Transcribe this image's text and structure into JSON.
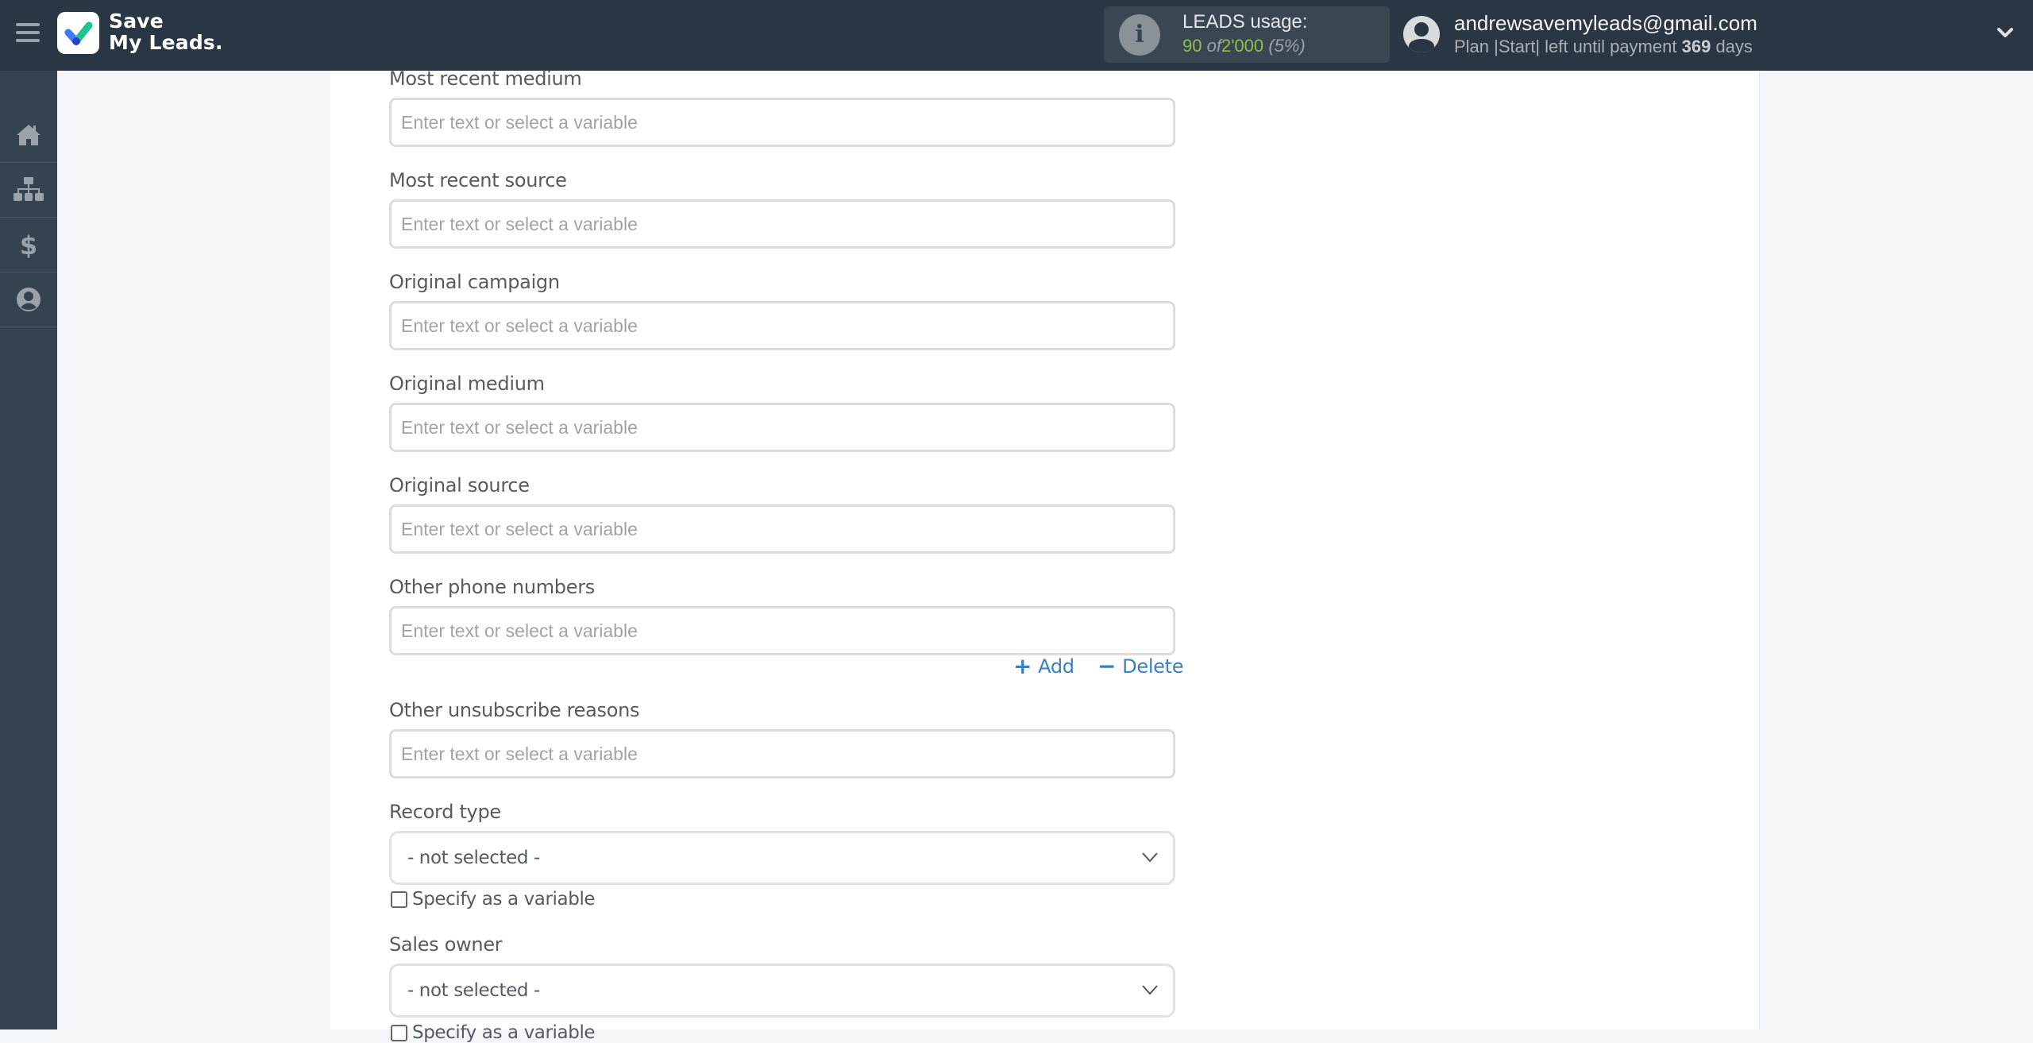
{
  "header": {
    "logo_line1": "Save",
    "logo_line2": "My Leads.",
    "usage": {
      "title": "LEADS usage:",
      "used": "90",
      "of_word": "of",
      "limit": "2'000",
      "percent": "(5%)",
      "used_color": "#8ec04a"
    },
    "user": {
      "email": "andrewsavemyleads@gmail.com",
      "plan_prefix": "Plan |Start| left until payment",
      "days": "369",
      "days_suffix": "days"
    }
  },
  "sidebar": {
    "items": [
      {
        "name": "home",
        "icon": "home-icon"
      },
      {
        "name": "connections",
        "icon": "sitemap-icon"
      },
      {
        "name": "billing",
        "icon": "dollar-icon"
      },
      {
        "name": "account",
        "icon": "user-circle-icon"
      }
    ]
  },
  "form": {
    "fields": [
      {
        "label": "Most recent medium",
        "placeholder": "Enter text or select a variable",
        "value": ""
      },
      {
        "label": "Most recent source",
        "placeholder": "Enter text or select a variable",
        "value": ""
      },
      {
        "label": "Original campaign",
        "placeholder": "Enter text or select a variable",
        "value": ""
      },
      {
        "label": "Original medium",
        "placeholder": "Enter text or select a variable",
        "value": ""
      },
      {
        "label": "Original source",
        "placeholder": "Enter text or select a variable",
        "value": ""
      },
      {
        "label": "Other phone numbers",
        "placeholder": "Enter text or select a variable",
        "value": ""
      },
      {
        "label": "Other unsubscribe reasons",
        "placeholder": "Enter text or select a variable",
        "value": ""
      }
    ],
    "add_label": "Add",
    "delete_label": "Delete",
    "selects": [
      {
        "label": "Record type",
        "value": "- not selected -",
        "checkbox_label": "Specify as a variable",
        "checked": false
      },
      {
        "label": "Sales owner",
        "value": "- not selected -",
        "checkbox_label": "Specify as a variable",
        "checked": false
      }
    ],
    "link_color": "#3a7fc1"
  }
}
